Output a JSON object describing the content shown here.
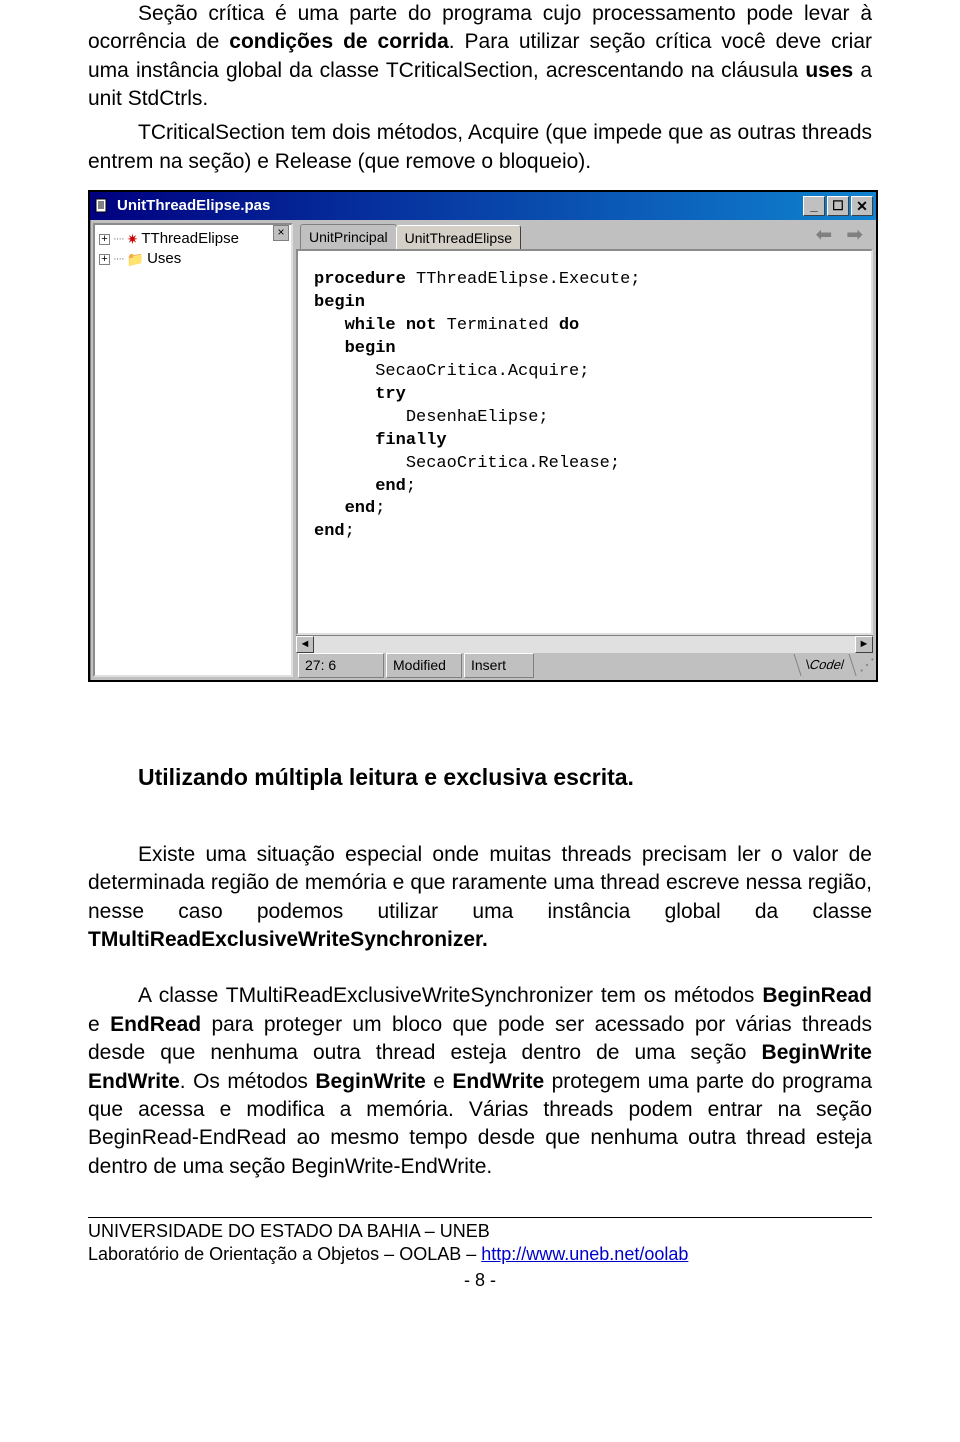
{
  "para1": {
    "t1": "Seção crítica é uma parte do programa cujo processamento pode levar à ocorrência de ",
    "b1": "condições de corrida",
    "t2": ". Para utilizar seção crítica você deve criar uma instância global da classe TCriticalSection, acrescentando na cláusula ",
    "b2": "uses",
    "t3": " a unit StdCtrls."
  },
  "para2": "TCriticalSection tem dois métodos, Acquire (que impede que as outras threads entrem na seção) e Release (que remove o bloqueio).",
  "ide": {
    "title": "UnitThreadElipse.pas",
    "tree": {
      "item1": "TThreadElipse",
      "item2": "Uses"
    },
    "tabs": {
      "t1": "UnitPrincipal",
      "t2": "UnitThreadElipse"
    },
    "code": {
      "l1a": "procedure",
      "l1b": " TThreadElipse.Execute;",
      "l2": "begin",
      "l3a": "   ",
      "l3b": "while not",
      "l3c": " Terminated ",
      "l3d": "do",
      "l4": "   begin",
      "l5": "      SecaoCritica.Acquire;",
      "l6": "      try",
      "l7": "         DesenhaElipse;",
      "l8": "      finally",
      "l9": "         SecaoCritica.Release;",
      "l10a": "      ",
      "l10b": "end",
      "l10c": ";",
      "l11a": "   ",
      "l11b": "end",
      "l11c": ";",
      "l12a": "end",
      "l12b": ";"
    },
    "status": {
      "pos": "27: 6",
      "mod": "Modified",
      "ins": "Insert",
      "tab": "Code"
    }
  },
  "h2": "Utilizando múltipla leitura e exclusiva escrita.",
  "p3": {
    "t1": "Existe uma situação especial onde muitas threads precisam ler  o valor de determinada região de memória e que raramente uma thread escreve nessa região, nesse caso podemos utilizar uma instância global da classe ",
    "b1": "TMultiReadExclusiveWriteSynchronizer.",
    "t2": ""
  },
  "p4": {
    "t1": "A classe TMultiReadExclusiveWriteSynchronizer tem os métodos ",
    "b1": "BeginRead",
    "t2": " e ",
    "b2": "EndRead",
    "t3": " para proteger um bloco que pode ser acessado por várias threads desde que nenhuma outra thread esteja dentro de uma seção ",
    "b3": "BeginWrite EndWrite",
    "t4": ". Os métodos ",
    "b4": "BeginWrite",
    "t5": " e ",
    "b5": "EndWrite",
    "t6": " protegem uma parte do programa que acessa e modifica a memória. Várias threads podem entrar na seção BeginRead-EndRead ao mesmo tempo desde que nenhuma outra thread esteja dentro de uma seção BeginWrite-EndWrite."
  },
  "footer": {
    "l1": "UNIVERSIDADE DO ESTADO DA BAHIA – UNEB",
    "l2a": "Laboratório de Orientação a Objetos – OOLAB – ",
    "l2b": "http://www.uneb.net/oolab",
    "page": "- 8 -"
  }
}
